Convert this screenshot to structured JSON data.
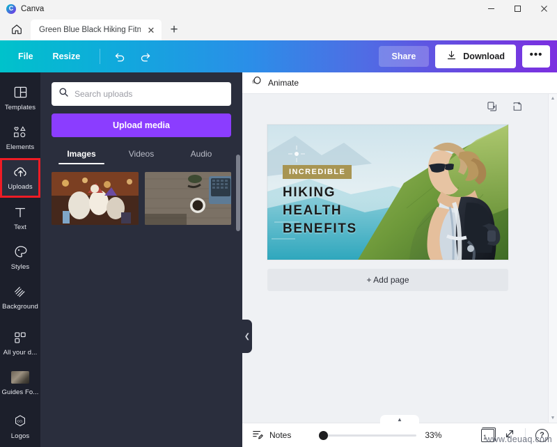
{
  "window": {
    "app_name": "Canva",
    "logo_letter": "C",
    "minimize": "–",
    "maximize": "☐",
    "close": "✕"
  },
  "tabs": {
    "home_icon": "home-icon",
    "active_tab_title": "Green Blue Black Hiking Fitn",
    "close_label": "✕",
    "new_tab_label": "+"
  },
  "toolbar": {
    "file_label": "File",
    "resize_label": "Resize",
    "undo_icon": "undo-icon",
    "redo_icon": "redo-icon",
    "share_label": "Share",
    "download_label": "Download",
    "more_label": "•••"
  },
  "rail": {
    "items": [
      {
        "label": "Templates",
        "icon": "templates-icon",
        "active": false
      },
      {
        "label": "Elements",
        "icon": "elements-icon",
        "active": false
      },
      {
        "label": "Uploads",
        "icon": "uploads-cloud-icon",
        "active": true
      },
      {
        "label": "Text",
        "icon": "text-icon",
        "active": false
      },
      {
        "label": "Styles",
        "icon": "styles-palette-icon",
        "active": false
      },
      {
        "label": "Background",
        "icon": "background-icon",
        "active": false
      },
      {
        "label": "All your d...",
        "icon": "grid-icon",
        "active": false
      },
      {
        "label": "Guides Fo...",
        "icon": "folder-thumbnail-icon",
        "active": false
      },
      {
        "label": "Logos",
        "icon": "logos-badge-icon",
        "active": false
      }
    ]
  },
  "panel": {
    "search_placeholder": "Search uploads",
    "search_value": "",
    "search_icon": "search-icon",
    "upload_button_label": "Upload media",
    "tabs": [
      {
        "label": "Images",
        "active": true
      },
      {
        "label": "Videos",
        "active": false
      },
      {
        "label": "Audio",
        "active": false
      }
    ]
  },
  "canvas": {
    "animate_label": "Animate",
    "animate_icon": "animate-ring-icon",
    "duplicate_page_icon": "duplicate-page-icon",
    "add_page_icon": "add-page-icon",
    "add_page_label": "+ Add page",
    "collapse_handle_icon": "chevron-left-icon"
  },
  "design": {
    "badge_text": "INCREDIBLE",
    "headline_line1": "HIKING",
    "headline_line2": "HEALTH",
    "headline_line3": "BENEFITS",
    "badge_color": "#a89552",
    "headline_color": "#1a1a1a"
  },
  "bottombar": {
    "notes_label": "Notes",
    "notes_icon": "notes-icon",
    "zoom_percent": "33%",
    "page_number": "1",
    "fullscreen_icon": "fullscreen-icon",
    "help_label": "?",
    "expand_handle_icon": "chevron-up-icon"
  },
  "watermark": {
    "text": "www.deuaq.com"
  },
  "colors": {
    "toolbar_gradient_start": "#00c2cb",
    "toolbar_gradient_end": "#7b2fe0",
    "upload_purple": "#8b3dff",
    "panel_dark": "#2a2e3d",
    "rail_dark": "#1c1f2b",
    "highlight_red": "#ee1c25",
    "canvas_bg": "#eff1f4"
  }
}
